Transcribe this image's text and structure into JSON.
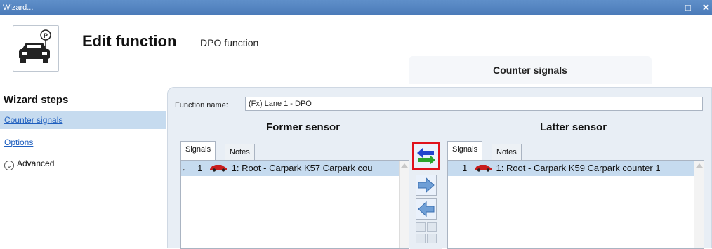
{
  "window": {
    "title": "Wizard...",
    "controls": {
      "restore": "□",
      "close": "✕"
    }
  },
  "header": {
    "title": "Edit function",
    "subtitle": "DPO function",
    "tab_label": "Counter signals",
    "icon": "parking-car-icon"
  },
  "sidebar": {
    "title": "Wizard steps",
    "items": [
      {
        "label": "Counter signals"
      },
      {
        "label": "Options"
      },
      {
        "label": "Advanced",
        "icon": "chevron-down-circle-icon"
      }
    ]
  },
  "main": {
    "function_name_label": "Function name:",
    "function_name_value": "(Fx) Lane 1 - DPO",
    "former": {
      "title": "Former sensor",
      "tabs": [
        "Signals",
        "Notes"
      ],
      "rows": [
        {
          "num": "1",
          "text": "1: Root - Carpark K57 Carpark cou"
        }
      ]
    },
    "latter": {
      "title": "Latter sensor",
      "tabs": [
        "Signals",
        "Notes"
      ],
      "rows": [
        {
          "num": "1",
          "text": "1: Root - Carpark K59 Carpark counter 1"
        }
      ]
    },
    "buttons": [
      "swap-arrows-icon",
      "move-right-icon",
      "move-left-icon"
    ]
  },
  "colors": {
    "titlebar": "#4a7ab8",
    "selection": "#c6dbef",
    "highlight": "#e0111b",
    "car": "#c81e1e"
  }
}
